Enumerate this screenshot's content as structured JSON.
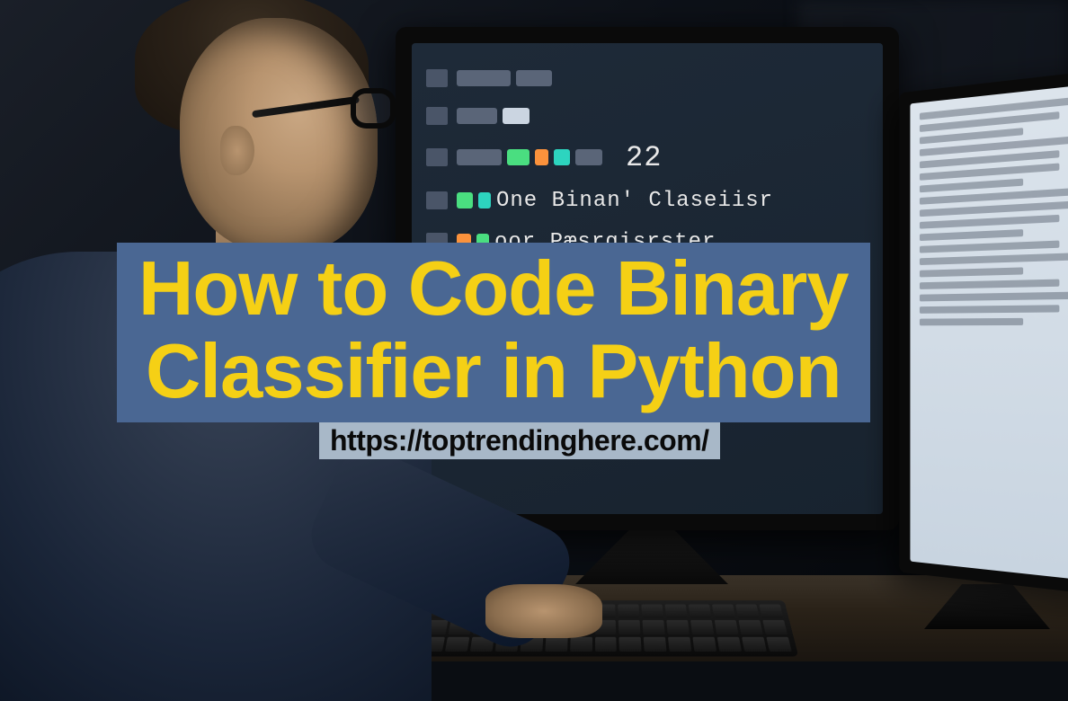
{
  "overlay": {
    "title_line1": "How to Code Binary",
    "title_line2": "Classifier in Python",
    "url": "https://toptrendinghere.com/"
  },
  "monitor_main": {
    "code_text_1": "One Binan' Claseiisr",
    "code_text_2": "oor Pæsrgisrster",
    "code_number": "22"
  },
  "colors": {
    "title_bg": "#4a6793",
    "title_fg": "#f5d015",
    "url_bg": "#a8b8c8",
    "url_fg": "#0a0a0a"
  }
}
